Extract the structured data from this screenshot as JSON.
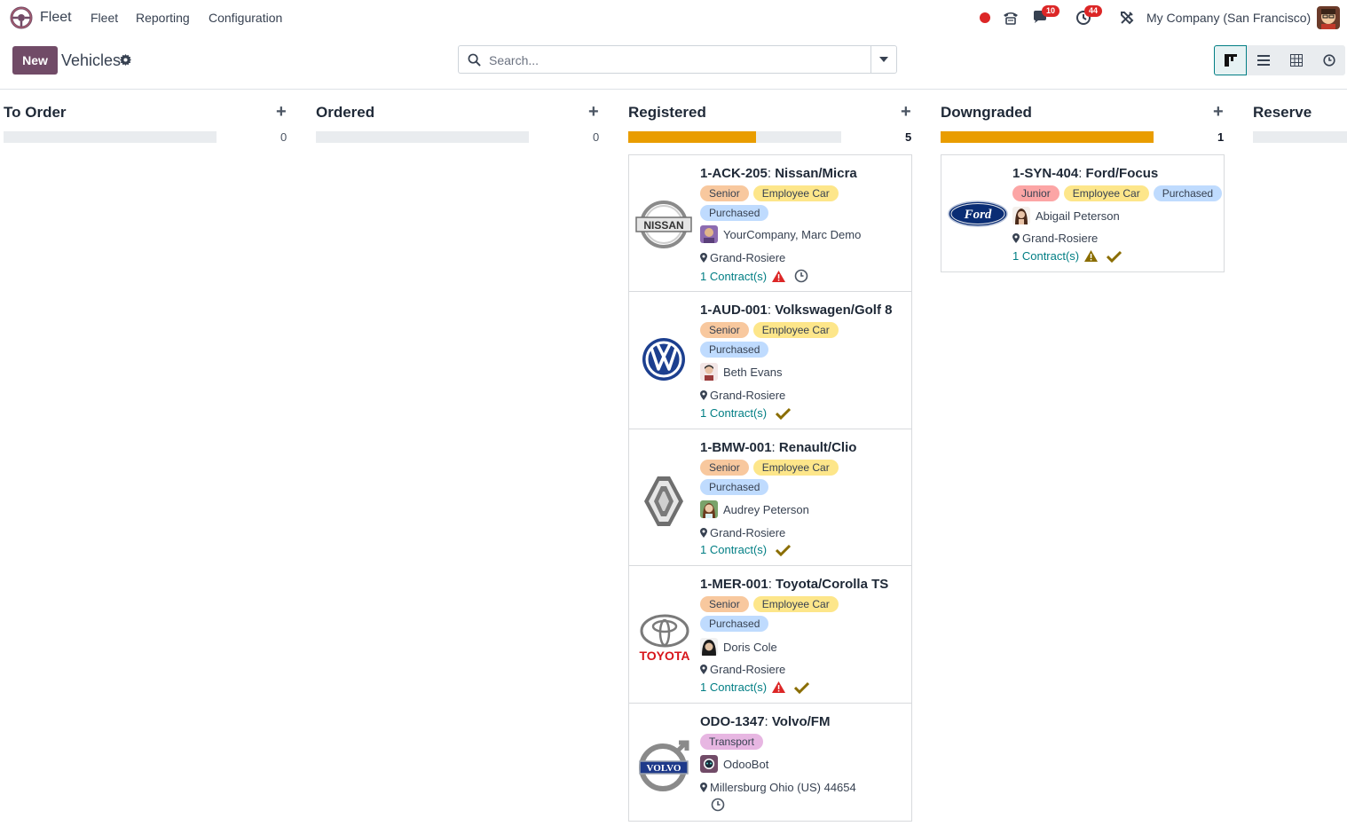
{
  "nav": {
    "app_name": "Fleet",
    "menu": [
      "Fleet",
      "Reporting",
      "Configuration"
    ],
    "messages_count": "10",
    "activities_count": "44",
    "company": "My Company (San Francisco)"
  },
  "control": {
    "new_label": "New",
    "title": "Vehicles",
    "search_placeholder": "Search..."
  },
  "colors": {
    "primary": "#714B67",
    "progress": "#e99d00",
    "link": "#017e84",
    "danger": "#dc2626",
    "check": "#8a6d00"
  },
  "columns": [
    {
      "title": "To Order",
      "count": "0",
      "progress": 0
    },
    {
      "title": "Ordered",
      "count": "0",
      "progress": 0
    },
    {
      "title": "Registered",
      "count": "5",
      "progress": 0.6
    },
    {
      "title": "Downgraded",
      "count": "1",
      "progress": 1.0
    },
    {
      "title": "Reserve"
    }
  ],
  "cards": {
    "nissan": {
      "plate": "1-ACK-205",
      "model": "Nissan/Micra",
      "tags": [
        "Senior",
        "Employee Car",
        "Purchased"
      ],
      "driver": "YourCompany, Marc Demo",
      "location": "Grand-Rosiere",
      "contracts": "1 Contract(s)",
      "brand_text": "NISSAN"
    },
    "vw": {
      "plate": "1-AUD-001",
      "model": "Volkswagen/Golf 8",
      "tags": [
        "Senior",
        "Employee Car",
        "Purchased"
      ],
      "driver": "Beth Evans",
      "location": "Grand-Rosiere",
      "contracts": "1 Contract(s)"
    },
    "renault": {
      "plate": "1-BMW-001",
      "model": "Renault/Clio",
      "tags": [
        "Senior",
        "Employee Car",
        "Purchased"
      ],
      "driver": "Audrey Peterson",
      "location": "Grand-Rosiere",
      "contracts": "1 Contract(s)"
    },
    "toyota": {
      "plate": "1-MER-001",
      "model": "Toyota/Corolla TS",
      "tags": [
        "Senior",
        "Employee Car",
        "Purchased"
      ],
      "driver": "Doris Cole",
      "location": "Grand-Rosiere",
      "contracts": "1 Contract(s)",
      "brand_text": "TOYOTA"
    },
    "volvo": {
      "plate": "ODO-1347",
      "model": "Volvo/FM",
      "tags": [
        "Transport"
      ],
      "driver": "OdooBot",
      "location": "Millersburg Ohio (US) 44654",
      "brand_text": "VOLVO"
    },
    "ford": {
      "plate": "1-SYN-404",
      "model": "Ford/Focus",
      "tags": [
        "Junior",
        "Employee Car",
        "Purchased"
      ],
      "driver": "Abigail Peterson",
      "location": "Grand-Rosiere",
      "contracts": "1 Contract(s)",
      "brand_text": "Ford"
    }
  }
}
